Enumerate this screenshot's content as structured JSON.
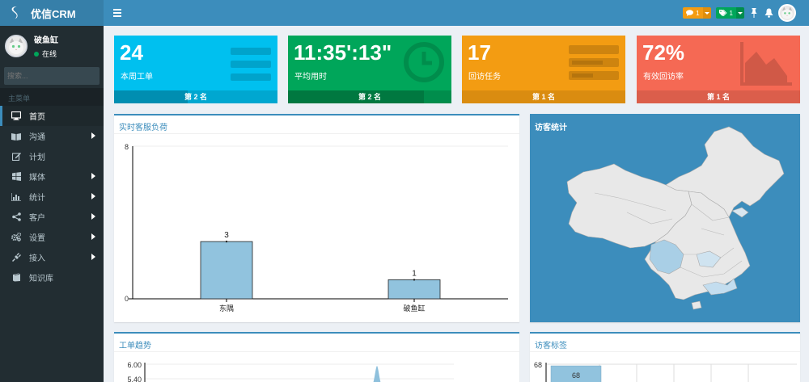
{
  "app": {
    "name": "优信CRM"
  },
  "user": {
    "name": "破鱼缸",
    "status": "在线"
  },
  "search": {
    "placeholder": "搜索..."
  },
  "menu": {
    "header": "主菜单",
    "items": [
      {
        "label": "首页",
        "icon": "monitor-icon",
        "active": true,
        "arrow": false
      },
      {
        "label": "沟通",
        "icon": "book-icon",
        "active": false,
        "arrow": true
      },
      {
        "label": "计划",
        "icon": "edit-icon",
        "active": false,
        "arrow": false
      },
      {
        "label": "媒体",
        "icon": "windows-icon",
        "active": false,
        "arrow": true
      },
      {
        "label": "统计",
        "icon": "bar-chart-icon",
        "active": false,
        "arrow": true
      },
      {
        "label": "客户",
        "icon": "share-icon",
        "active": false,
        "arrow": true
      },
      {
        "label": "设置",
        "icon": "gears-icon",
        "active": false,
        "arrow": true
      },
      {
        "label": "接入",
        "icon": "plug-icon",
        "active": false,
        "arrow": true
      },
      {
        "label": "知识库",
        "icon": "archive-icon",
        "active": false,
        "arrow": false
      }
    ]
  },
  "header": {
    "messages_count": "1",
    "tags_count": "1"
  },
  "stats": [
    {
      "value": "24",
      "label": "本周工单",
      "footer": "第 2 名",
      "color": "#00c0ef",
      "foot_color": "#00a7d0",
      "progress": 0.45,
      "icon": "list-icon"
    },
    {
      "value": "11:35':13\"",
      "label": "平均用时",
      "footer": "第 2 名",
      "color": "#00a65a",
      "foot_color": "#008d4c",
      "progress": 0.83,
      "icon": "clock-icon"
    },
    {
      "value": "17",
      "label": "回访任务",
      "footer": "第 1 名",
      "color": "#f39c12",
      "foot_color": "#da8c10",
      "progress": 0.0,
      "icon": "tasks-icon"
    },
    {
      "value": "72%",
      "label": "有效回访率",
      "footer": "第 1 名",
      "color": "#f56954",
      "foot_color": "#db5e4b",
      "progress": 0.0,
      "icon": "area-chart-icon"
    }
  ],
  "panels": {
    "load_title": "实时客服负荷",
    "map_title": "访客统计",
    "trend_title": "工单趋势",
    "tags_title": "访客标签"
  },
  "chart_data": [
    {
      "type": "bar",
      "categories": [
        "东隅",
        "破鱼缸"
      ],
      "values": [
        3,
        1
      ],
      "title": "实时客服负荷",
      "xlabel": "",
      "ylabel": "",
      "ylim": [
        0,
        8
      ],
      "yticks": [
        "8",
        "0"
      ],
      "grid": true,
      "color": "#91c3de"
    },
    {
      "type": "line",
      "title": "工单趋势",
      "ylim_visible": [
        "6.00",
        "5.40"
      ]
    },
    {
      "type": "bar",
      "title": "访客标签",
      "values": [
        68
      ],
      "yticks": [
        "68"
      ]
    }
  ]
}
